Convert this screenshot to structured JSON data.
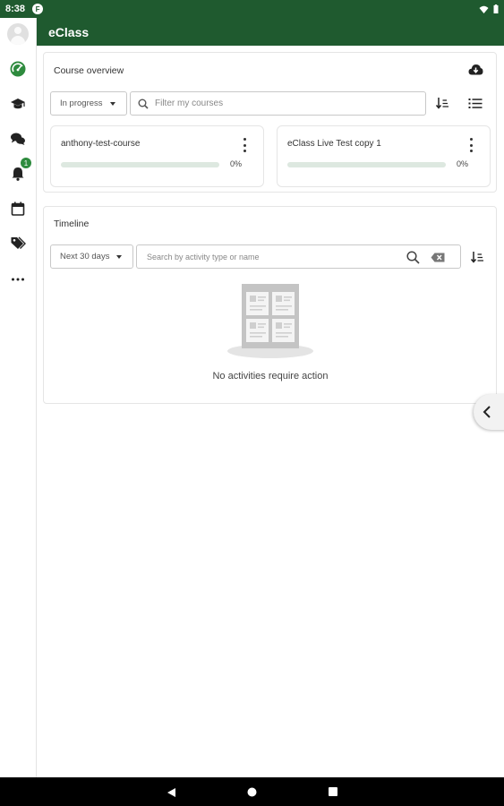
{
  "status_bar": {
    "time": "8:38",
    "notif_letter": "F"
  },
  "app": {
    "title": "eClass"
  },
  "sidebar": {
    "items": [
      {
        "name": "dashboard",
        "icon": "dashboard-icon"
      },
      {
        "name": "my-courses",
        "icon": "graduation-cap-icon"
      },
      {
        "name": "messages",
        "icon": "chat-icon"
      },
      {
        "name": "notifications",
        "icon": "bell-icon",
        "badge": "1"
      },
      {
        "name": "calendar",
        "icon": "calendar-icon"
      },
      {
        "name": "tags",
        "icon": "tag-icon"
      },
      {
        "name": "more",
        "icon": "more-icon"
      }
    ],
    "notification_badge": "1"
  },
  "course_overview": {
    "title": "Course overview",
    "filter_select": "In progress",
    "search_placeholder": "Filter my courses",
    "courses": [
      {
        "name": "anthony-test-course",
        "progress_text": "0%",
        "progress": 0
      },
      {
        "name": "eClass Live Test copy 1",
        "progress_text": "0%",
        "progress": 0
      }
    ]
  },
  "timeline": {
    "title": "Timeline",
    "range_select": "Next 30 days",
    "search_placeholder": "Search by activity type or name",
    "empty_message": "No activities require action"
  },
  "colors": {
    "brand": "#1f5a2f",
    "accent": "#2e8b3e",
    "progress_track": "#dde8e0"
  }
}
